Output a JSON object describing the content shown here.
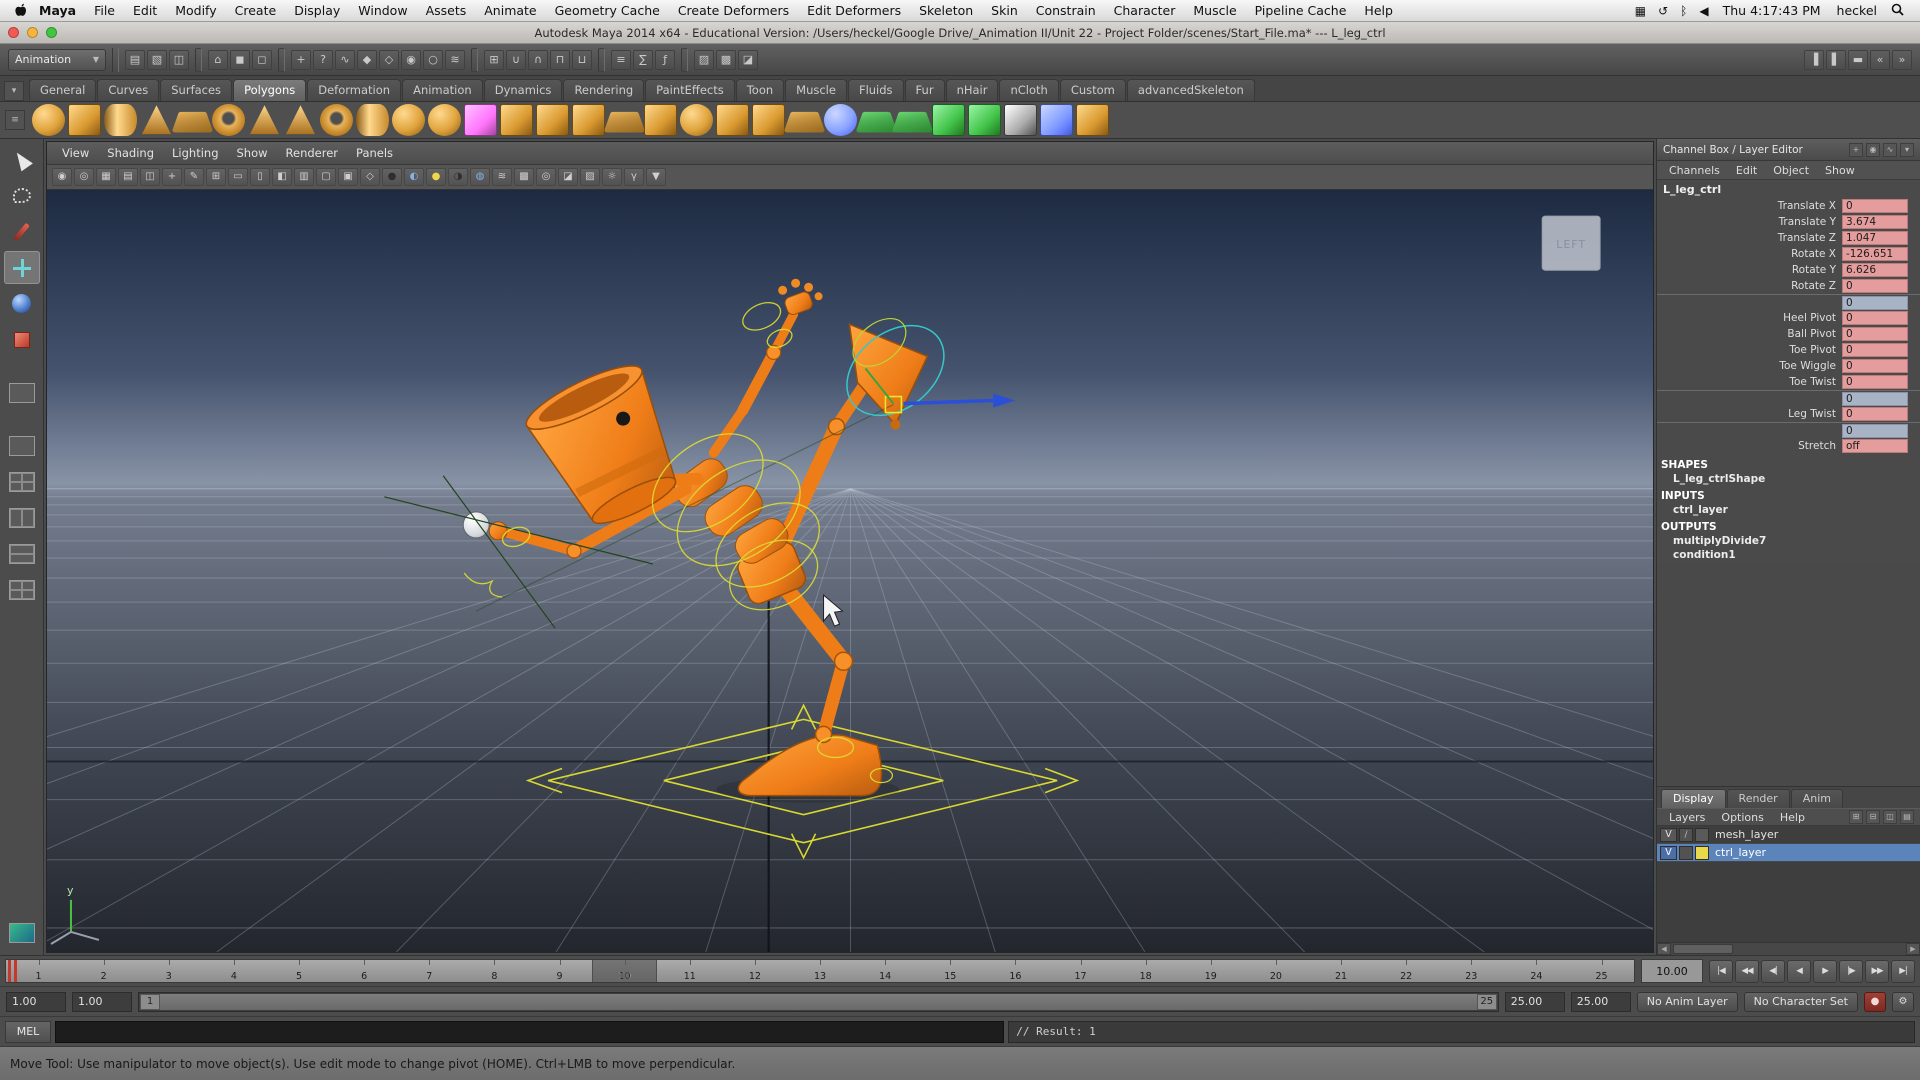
{
  "menubar": {
    "app_name": "Maya",
    "items": [
      "File",
      "Edit",
      "Modify",
      "Create",
      "Display",
      "Window",
      "Assets",
      "Animate",
      "Geometry Cache",
      "Create Deformers",
      "Edit Deformers",
      "Skeleton",
      "Skin",
      "Constrain",
      "Character",
      "Muscle",
      "Pipeline Cache",
      "Help"
    ],
    "status_icons": [
      {
        "n": "display-menu-icon",
        "g": "▦"
      },
      {
        "n": "time-machine-icon",
        "g": "↺"
      },
      {
        "n": "bluetooth-icon",
        "g": "ᛒ"
      },
      {
        "n": "volume-icon",
        "g": "◀"
      }
    ],
    "clock": "Thu 4:17:43 PM",
    "username": "heckel"
  },
  "titlebar": {
    "title": "Autodesk Maya 2014 x64 - Educational Version: /Users/heckel/Google Drive/_Animation II/Unit 22 - Project Folder/scenes/Start_File.ma*  ---  L_leg_ctrl"
  },
  "toolbar": {
    "menuset_value": "Animation",
    "icons": [
      {
        "n": "new-scene-button",
        "g": "▤"
      },
      {
        "n": "open-scene-button",
        "g": "▧"
      },
      {
        "n": "save-scene-button",
        "g": "◫"
      },
      {
        "n": "group-divider",
        "cls": "tbdiv"
      },
      {
        "n": "select-by-hierarchy-button",
        "g": "⌂"
      },
      {
        "n": "select-by-object-button",
        "g": "◼"
      },
      {
        "n": "select-by-component-button",
        "g": "◻"
      },
      {
        "n": "group-divider",
        "cls": "tbdiv"
      },
      {
        "n": "select-mask-handles-button",
        "g": "+"
      },
      {
        "n": "select-mask-joints-button",
        "g": "?"
      },
      {
        "n": "select-mask-curves-button",
        "g": "∿"
      },
      {
        "n": "select-mask-surfaces-button",
        "g": "◆"
      },
      {
        "n": "select-mask-deformations-button",
        "g": "◇"
      },
      {
        "n": "select-mask-dynamics-button",
        "g": "◉"
      },
      {
        "n": "select-mask-rendering-button",
        "g": "○"
      },
      {
        "n": "select-mask-misc-button",
        "g": "≋"
      },
      {
        "n": "group-divider",
        "cls": "tbdiv"
      },
      {
        "n": "snap-to-grids-button",
        "g": "⊞"
      },
      {
        "n": "snap-to-curves-button",
        "g": "∪"
      },
      {
        "n": "snap-to-points-button",
        "g": "∩"
      },
      {
        "n": "snap-to-planes-button",
        "g": "⊓"
      },
      {
        "n": "make-live-button",
        "g": "⊔"
      },
      {
        "n": "group-divider",
        "cls": "tbdiv"
      },
      {
        "n": "inputs-to-selected-button",
        "g": "≡"
      },
      {
        "n": "outputs-of-selected-button",
        "g": "∑"
      },
      {
        "n": "construction-history-button",
        "g": "ƒ"
      },
      {
        "n": "group-divider",
        "cls": "tbdiv"
      },
      {
        "n": "render-current-frame-button",
        "g": "▨"
      },
      {
        "n": "ipr-render-button",
        "g": "▩"
      },
      {
        "n": "render-settings-button",
        "g": "◪"
      }
    ],
    "right_icons": [
      {
        "n": "show-attribute-editor-button",
        "g": "▐"
      },
      {
        "n": "show-tool-settings-button",
        "g": "▌"
      },
      {
        "n": "show-channel-box-button",
        "g": "▬"
      },
      {
        "n": "collapse-bar-button",
        "g": "«"
      },
      {
        "n": "expand-bar-button",
        "g": "»"
      }
    ]
  },
  "shelf": {
    "tabs": [
      {
        "label": "General"
      },
      {
        "label": "Curves"
      },
      {
        "label": "Surfaces"
      },
      {
        "label": "Polygons",
        "state": "active"
      },
      {
        "label": "Deformation"
      },
      {
        "label": "Animation"
      },
      {
        "label": "Dynamics"
      },
      {
        "label": "Rendering"
      },
      {
        "label": "PaintEffects"
      },
      {
        "label": "Toon"
      },
      {
        "label": "Muscle"
      },
      {
        "label": "Fluids"
      },
      {
        "label": "Fur"
      },
      {
        "label": "nHair"
      },
      {
        "label": "nCloth"
      },
      {
        "label": "Custom"
      },
      {
        "label": "advancedSkeleton"
      }
    ],
    "icons": [
      {
        "n": "polySphere-icon",
        "cls": "shp-sphere"
      },
      {
        "n": "polyCube-icon",
        "cls": "shp-cube"
      },
      {
        "n": "polyCylinder-icon",
        "cls": "shp-cyl"
      },
      {
        "n": "polyCone-icon",
        "cls": "shp-cone"
      },
      {
        "n": "polyPlane-icon",
        "cls": "shp-plane"
      },
      {
        "n": "polyTorus-icon",
        "cls": "shp-torus"
      },
      {
        "n": "polyPrism-icon",
        "cls": "shp-cone"
      },
      {
        "n": "polyPyramid-icon",
        "cls": "shp-cone"
      },
      {
        "n": "polyPipe-icon",
        "cls": "shp-torus"
      },
      {
        "n": "polyHelix-icon",
        "cls": "shp-cyl"
      },
      {
        "n": "polySoccerBall-icon",
        "cls": "shp-sphere"
      },
      {
        "n": "polyPlatonic-icon",
        "cls": "shp-sphere"
      },
      {
        "n": "sculpt-geometry-icon",
        "cls": "shp-cube c-purple"
      },
      {
        "n": "mirror-geometry-icon",
        "cls": "shp-cube"
      },
      {
        "n": "combine-icon",
        "cls": "shp-cube"
      },
      {
        "n": "separate-icon",
        "cls": "shp-cube"
      },
      {
        "n": "fill-hole-icon",
        "cls": "shp-plane"
      },
      {
        "n": "reduce-icon",
        "cls": "shp-cube"
      },
      {
        "n": "smooth-icon",
        "cls": "shp-sphere"
      },
      {
        "n": "extrude-icon",
        "cls": "shp-cube"
      },
      {
        "n": "bevel-icon",
        "cls": "shp-cube"
      },
      {
        "n": "bridge-icon",
        "cls": "shp-plane"
      },
      {
        "n": "booleans-icon",
        "cls": "shp-sphere c-blue"
      },
      {
        "n": "append-to-polygon-icon",
        "cls": "shp-plane c-green"
      },
      {
        "n": "split-polygon-icon",
        "cls": "shp-plane c-green"
      },
      {
        "n": "insert-edge-loop-icon",
        "cls": "shp-cube c-green"
      },
      {
        "n": "offset-edge-loop-icon",
        "cls": "shp-cube c-green"
      },
      {
        "n": "uv-checker-icon",
        "cls": "shp-cube c-bw"
      },
      {
        "n": "crease-tool-icon",
        "cls": "shp-cube c-blue"
      },
      {
        "n": "quad-draw-icon",
        "cls": "shp-cube"
      }
    ]
  },
  "toolbox": {
    "tools": [
      "select-tool",
      "lasso-tool",
      "paint-select-tool",
      "move-tool",
      "rotate-tool",
      "scale-tool"
    ],
    "active_tool": "move-tool"
  },
  "viewport": {
    "menus": [
      "View",
      "Shading",
      "Lighting",
      "Show",
      "Renderer",
      "Panels"
    ],
    "view_label": "LEFT",
    "axis_label": "y",
    "icons": [
      {
        "n": "select-camera-icon",
        "g": "◉"
      },
      {
        "n": "lock-camera-icon",
        "g": "◎"
      },
      {
        "n": "camera-attributes-icon",
        "g": "▦"
      },
      {
        "n": "bookmarks-icon",
        "g": "▤"
      },
      {
        "n": "image-plane-icon",
        "g": "◫"
      },
      {
        "n": "view-compass-icon",
        "g": "+"
      },
      {
        "n": "grease-pencil-icon",
        "g": "✎"
      },
      {
        "n": "grid-toggle-icon",
        "g": "⊞"
      },
      {
        "n": "film-gate-icon",
        "g": "▭"
      },
      {
        "n": "resolution-gate-icon",
        "g": "▯"
      },
      {
        "n": "gate-mask-icon",
        "g": "◧"
      },
      {
        "n": "field-chart-icon",
        "g": "▥"
      },
      {
        "n": "safe-action-icon",
        "g": "▢"
      },
      {
        "n": "safe-title-icon",
        "g": "▣"
      },
      {
        "n": "wireframe-icon",
        "g": "◇"
      },
      {
        "n": "shaded-mode-icon",
        "g": "●",
        "cls": "tint-dark"
      },
      {
        "n": "textured-mode-icon",
        "g": "◐",
        "cls": "tint-blue"
      },
      {
        "n": "use-all-lights-icon",
        "g": "●",
        "cls": "tint-yellow"
      },
      {
        "n": "shadows-icon",
        "g": "◑",
        "cls": "tint-dark"
      },
      {
        "n": "ambient-occlusion-icon",
        "g": "◍",
        "cls": "tint-blue"
      },
      {
        "n": "motion-blur-icon",
        "g": "≋"
      },
      {
        "n": "multisample-icon",
        "g": "▩"
      },
      {
        "n": "depth-of-field-icon",
        "g": "◎"
      },
      {
        "n": "isolate-select-icon",
        "g": "◪"
      },
      {
        "n": "x-ray-icon",
        "g": "▨"
      },
      {
        "n": "exposure-icon",
        "g": "☼"
      },
      {
        "n": "gamma-icon",
        "g": "γ"
      },
      {
        "n": "renderer-menu-icon",
        "g": "▼"
      }
    ]
  },
  "channel_box": {
    "header": "Channel Box / Layer Editor",
    "header_icons": [
      {
        "n": "manip-state-icon",
        "g": "+"
      },
      {
        "n": "speed-state-icon",
        "g": "◉"
      },
      {
        "n": "hyperbolic-state-icon",
        "g": "∿"
      },
      {
        "n": "pin-channel-box-icon",
        "g": "▾"
      }
    ],
    "menus": [
      "Channels",
      "Edit",
      "Object",
      "Show"
    ],
    "node_name": "L_leg_ctrl",
    "rows": [
      {
        "label": "Translate X",
        "value": "0",
        "cls": "keyed"
      },
      {
        "label": "Translate Y",
        "value": "3.674",
        "cls": "keyed"
      },
      {
        "label": "Translate Z",
        "value": "1.047",
        "cls": "keyed"
      },
      {
        "label": "Rotate X",
        "value": "-126.651",
        "cls": "keyed"
      },
      {
        "label": "Rotate Y",
        "value": "6.626",
        "cls": "keyed"
      },
      {
        "label": "Rotate Z",
        "value": "0",
        "cls": "keyed"
      },
      {
        "label": "",
        "value": "0",
        "cls": "muted"
      },
      {
        "label": "Heel Pivot",
        "value": "0",
        "cls": "keyed"
      },
      {
        "label": "Ball Pivot",
        "value": "0",
        "cls": "keyed"
      },
      {
        "label": "Toe Pivot",
        "value": "0",
        "cls": "keyed"
      },
      {
        "label": "Toe Wiggle",
        "value": "0",
        "cls": "keyed"
      },
      {
        "label": "Toe Twist",
        "value": "0",
        "cls": "keyed"
      },
      {
        "label": "",
        "value": "0",
        "cls": "muted"
      },
      {
        "label": "Leg Twist",
        "value": "0",
        "cls": "keyed"
      },
      {
        "label": "",
        "value": "0",
        "cls": "muted"
      },
      {
        "label": "Stretch",
        "value": "off",
        "cls": "keyed"
      }
    ],
    "sections": [
      {
        "title": "SHAPES",
        "items": [
          "L_leg_ctrlShape"
        ]
      },
      {
        "title": "INPUTS",
        "items": [
          "ctrl_layer"
        ]
      },
      {
        "title": "OUTPUTS",
        "items": [
          "multiplyDivide7",
          "condition1"
        ]
      }
    ]
  },
  "layer_editor": {
    "tabs": [
      {
        "label": "Display",
        "state": "active"
      },
      {
        "label": "Render"
      },
      {
        "label": "Anim"
      }
    ],
    "menus": [
      "Layers",
      "Options",
      "Help"
    ],
    "icons": [
      {
        "n": "new-empty-layer-icon",
        "g": "⊞"
      },
      {
        "n": "new-layer-from-selected-icon",
        "g": "⊟"
      },
      {
        "n": "new-render-layer-icon",
        "g": "◫"
      },
      {
        "n": "layer-stack-icon",
        "g": "▤"
      }
    ],
    "layers": [
      {
        "name": "mesh_layer",
        "vis": "V",
        "type": "/",
        "swatch": "",
        "state": ""
      },
      {
        "name": "ctrl_layer",
        "vis": "V",
        "type": "",
        "swatch": "yellow",
        "state": "selected"
      }
    ]
  },
  "time_slider": {
    "ticks": [
      "1",
      "2",
      "3",
      "4",
      "5",
      "6",
      "7",
      "8",
      "9",
      "10",
      "11",
      "12",
      "13",
      "14",
      "15",
      "16",
      "17",
      "18",
      "19",
      "20",
      "21",
      "22",
      "23",
      "24",
      "25"
    ],
    "current_frame": "10",
    "current_time": "10.00",
    "playback_buttons": [
      {
        "n": "go-to-start-button",
        "g": "|◀"
      },
      {
        "n": "step-back-frame-button",
        "g": "◀◀"
      },
      {
        "n": "step-back-key-button",
        "g": "◀|"
      },
      {
        "n": "play-backwards-button",
        "g": "◀"
      },
      {
        "n": "play-forwards-button",
        "g": "▶"
      },
      {
        "n": "step-forward-key-button",
        "g": "|▶"
      },
      {
        "n": "step-forward-frame-button",
        "g": "▶▶"
      },
      {
        "n": "go-to-end-button",
        "g": "▶|"
      }
    ]
  },
  "range_slider": {
    "animation_start": "1.00",
    "playback_start": "1.00",
    "range_start_label": "1",
    "range_end_label": "25",
    "playback_end": "25.00",
    "animation_end": "25.00",
    "anim_layer_button": "No Anim Layer",
    "character_set_button": "No Character Set"
  },
  "command_line": {
    "label": "MEL",
    "input": "",
    "result": "// Result: 1"
  },
  "help_line": {
    "text": "Move Tool: Use manipulator to move object(s). Use edit mode to change pivot (HOME).  Ctrl+LMB to move perpendicular."
  }
}
